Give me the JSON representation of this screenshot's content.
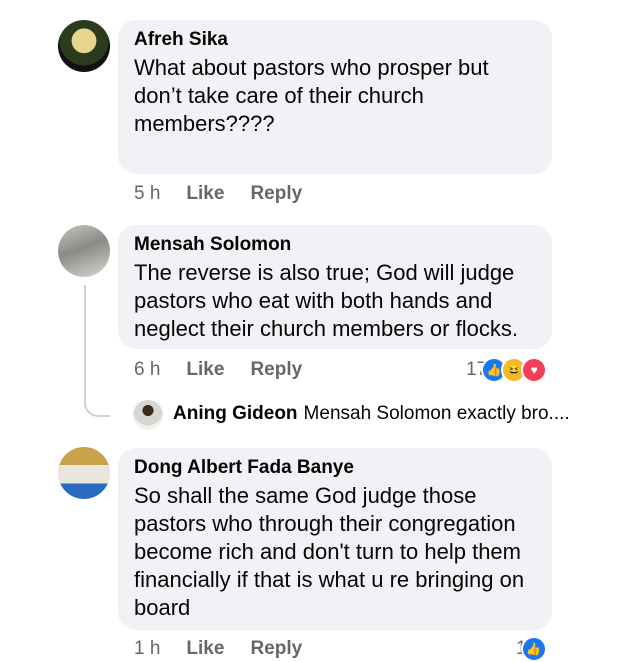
{
  "comments": [
    {
      "author": "Afreh Sika",
      "text": "What about pastors who prosper but don’t take care of their church members????",
      "time": "5 h",
      "like": "Like",
      "reply": "Reply"
    },
    {
      "author": "Mensah Solomon",
      "text": "The reverse is also true; God will judge pastors who eat with both hands and neglect their church members or flocks.",
      "time": "6 h",
      "like": "Like",
      "reply": "Reply",
      "reaction_count": "17"
    },
    {
      "author": "Dong Albert Fada Banye",
      "text": "So shall the same God judge those pastors who through their congregation become rich and don't turn to help them financially  if that is what u re bringing on board",
      "time": "1 h",
      "like": "Like",
      "reply": "Reply",
      "reaction_count": "1"
    }
  ],
  "reply_preview": {
    "author": "Aning Gideon",
    "text": "Mensah Solomon exactly bro...."
  },
  "colors": {
    "bubble": "#f0f2f5",
    "meta": "#65676b",
    "like": "#1877f2",
    "haha": "#f7b928",
    "love": "#f33e58"
  },
  "icons": [
    "like-reaction-icon",
    "haha-reaction-icon",
    "love-reaction-icon"
  ]
}
